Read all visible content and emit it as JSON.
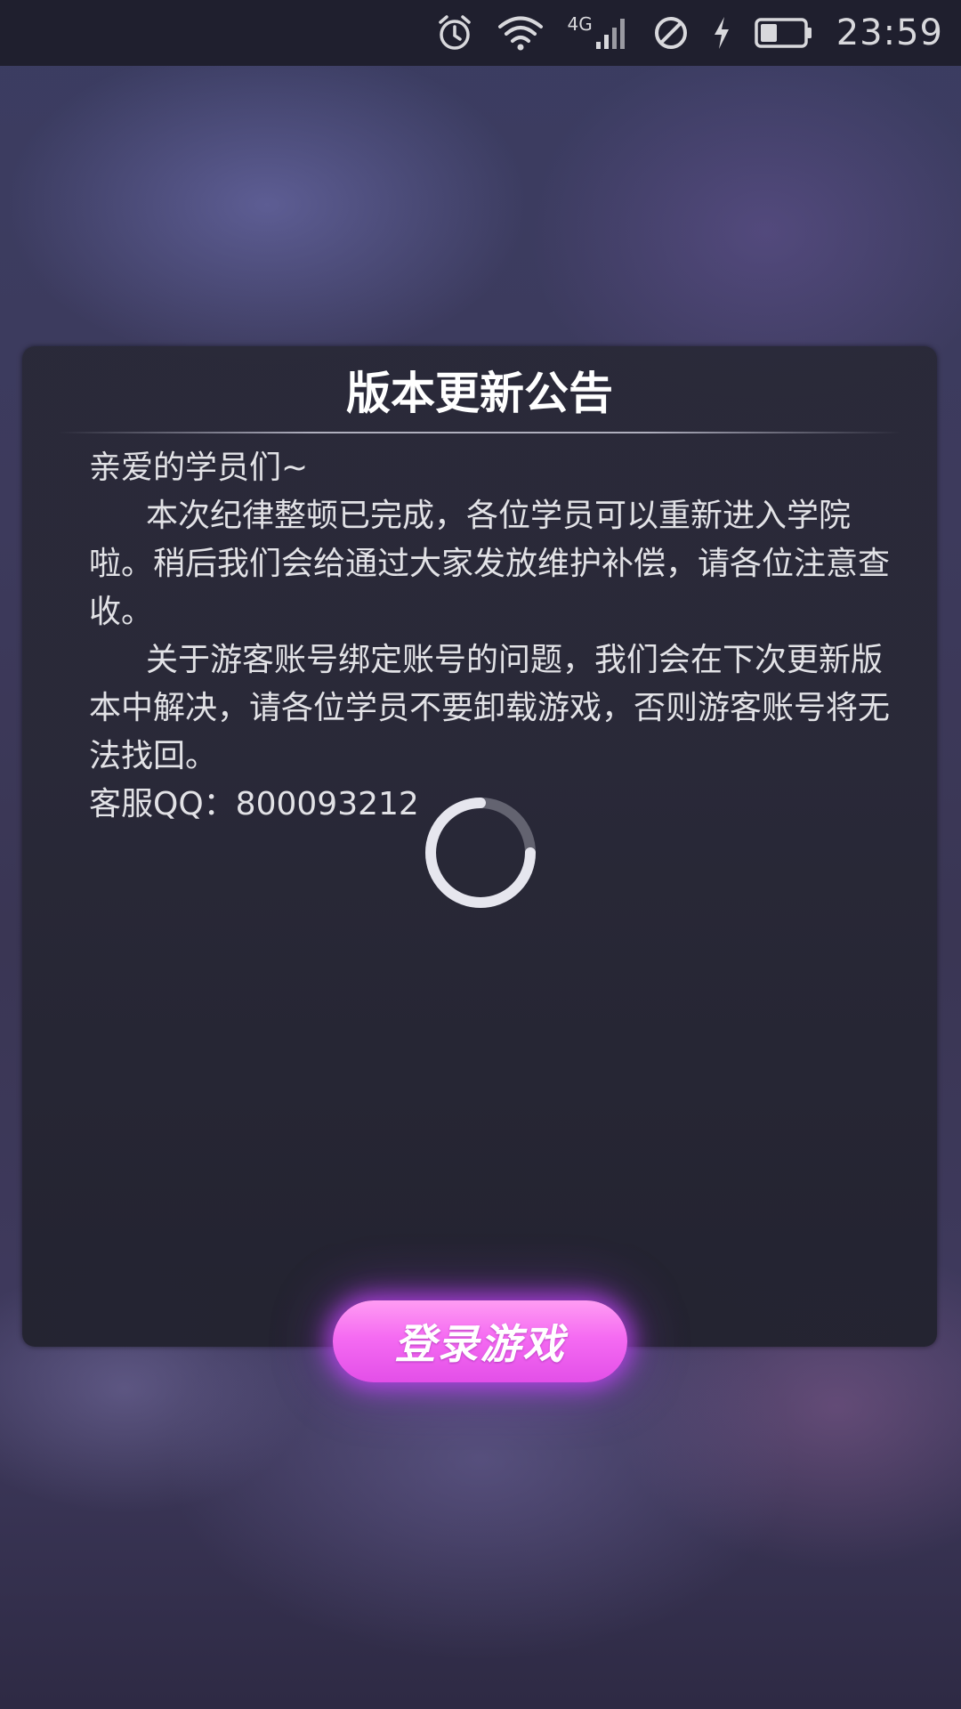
{
  "status_bar": {
    "time": "23:59",
    "network_type": "4G",
    "icons": [
      "alarm-icon",
      "wifi-icon",
      "cell-signal-icon",
      "do-not-disturb-icon",
      "charging-icon",
      "battery-icon"
    ],
    "battery_level": 0.4
  },
  "notice": {
    "title": "版本更新公告",
    "greeting": "亲爱的学员们~",
    "paragraph_1": "本次纪律整顿已完成，各位学员可以重新进入学院啦。稍后我们会给通过大家发放维护补偿，请各位注意查收。",
    "paragraph_2": "关于游客账号绑定账号的问题，我们会在下次更新版本中解决，请各位学员不要卸载游戏，否则游客账号将无法找回。",
    "customer_service": "客服QQ：800093212"
  },
  "loading": {
    "icon": "loading-spinner-icon"
  },
  "login_button": {
    "label": "登录游戏",
    "color": "#f56bf2"
  }
}
